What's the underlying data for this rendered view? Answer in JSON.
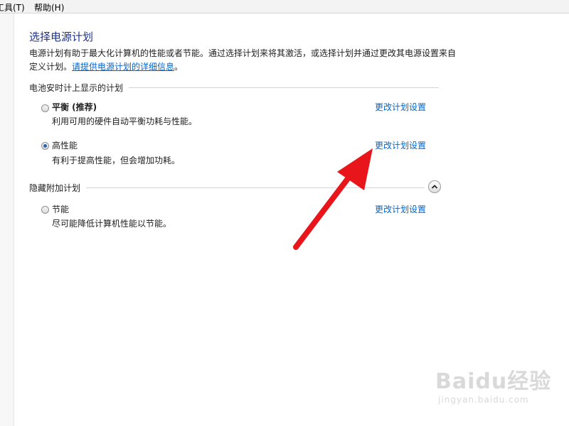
{
  "menubar": {
    "tools": "工具(T)",
    "help": "帮助(H)"
  },
  "page": {
    "title": "选择电源计划",
    "description": "电源计划有助于最大化计算机的性能或者节能。通过选择计划来将其激活，或选择计划并通过更改其电源设置来自定义计划。",
    "help_link": "请提供电源计划的详细信息"
  },
  "battery_section": {
    "label": "电池安时计上显示的计划",
    "plans": [
      {
        "name": "平衡 (推荐)",
        "description": "利用可用的硬件自动平衡功耗与性能。",
        "link": "更改计划设置",
        "selected": false
      },
      {
        "name": "高性能",
        "description": "有利于提高性能，但会增加功耗。",
        "link": "更改计划设置",
        "selected": true
      }
    ]
  },
  "hidden_section": {
    "label": "隐藏附加计划",
    "plans": [
      {
        "name": "节能",
        "description": "尽可能降低计算机性能以节能。",
        "link": "更改计划设置",
        "selected": false
      }
    ]
  },
  "watermark": {
    "brand": "Baidu经验",
    "url": "jingyan.baidu.com"
  },
  "colors": {
    "title": "#1e3287",
    "link": "#0066cc",
    "radio_dot": "#2a64b8",
    "arrow": "#e8161b"
  }
}
